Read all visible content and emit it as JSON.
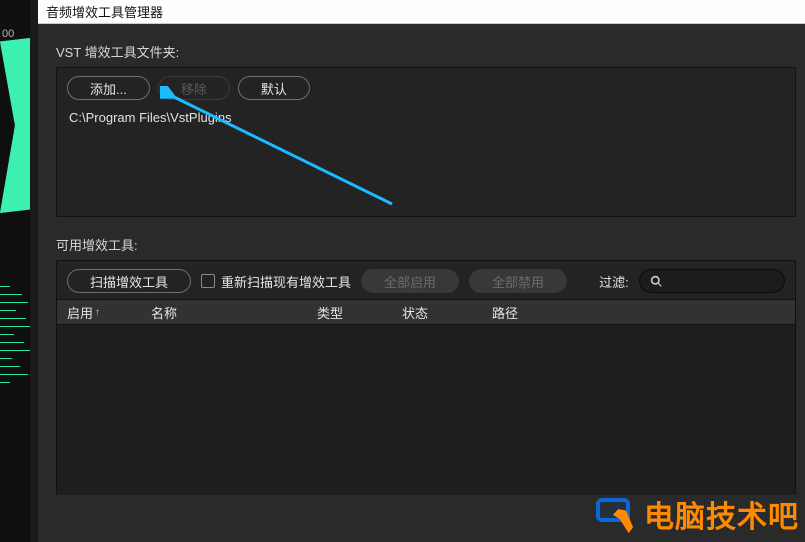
{
  "timeline": {
    "label": "00"
  },
  "titleBar": {
    "title": "音频增效工具管理器"
  },
  "folders": {
    "label": "VST 增效工具文件夹:",
    "buttons": {
      "add": "添加...",
      "remove": "移除",
      "default": "默认"
    },
    "paths": [
      "C:\\Program Files\\VstPlugins"
    ]
  },
  "plugins": {
    "label": "可用增效工具:",
    "buttons": {
      "scan": "扫描增效工具",
      "rescan": "重新扫描现有增效工具",
      "enableAll": "全部启用",
      "disableAll": "全部禁用"
    },
    "filterLabel": "过滤:",
    "searchPlaceholder": "",
    "columns": {
      "enable": "启用",
      "name": "名称",
      "type": "类型",
      "status": "状态",
      "path": "路径"
    }
  },
  "watermark": {
    "text": "电脑技术吧"
  }
}
